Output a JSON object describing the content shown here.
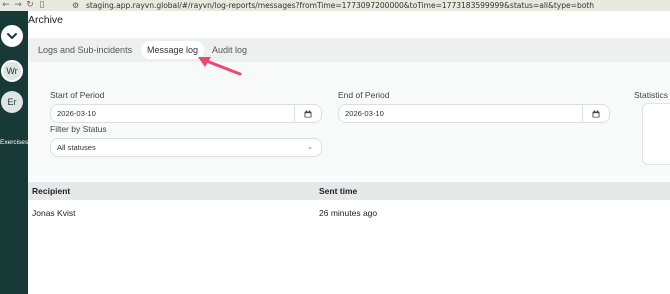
{
  "browser": {
    "back_icon": "arrow-left-icon",
    "forward_icon": "arrow-right-icon",
    "reload_icon": "reload-icon",
    "url": "staging.app.rayvn.global/#/rayvn/log-reports/messages?fromTime=1773097200000&toTime=1773183599999&status=all&type=both"
  },
  "sidebar": {
    "avatars": [
      {
        "label": "Wr"
      },
      {
        "label": "Er"
      }
    ],
    "bottom_label": "Exercises"
  },
  "page": {
    "title": "Archive"
  },
  "tabs": [
    {
      "label": "Logs and Sub-incidents",
      "active": false
    },
    {
      "label": "Message log",
      "active": true
    },
    {
      "label": "Audit log",
      "active": false
    }
  ],
  "filters": {
    "start_label": "Start of Period",
    "start_value": "2026-03-10",
    "end_label": "End of Period",
    "end_value": "2026-03-10",
    "status_label": "Filter by Status",
    "status_value": "All statuses",
    "statistics_label": "Statistics"
  },
  "table": {
    "columns": [
      "Recipient",
      "Sent time"
    ],
    "rows": [
      {
        "recipient": "Jonas Kvist",
        "sent_time": "26 minutes ago"
      }
    ]
  },
  "colors": {
    "sidebar": "#183a36",
    "annotation_arrow": "#f0466e"
  }
}
